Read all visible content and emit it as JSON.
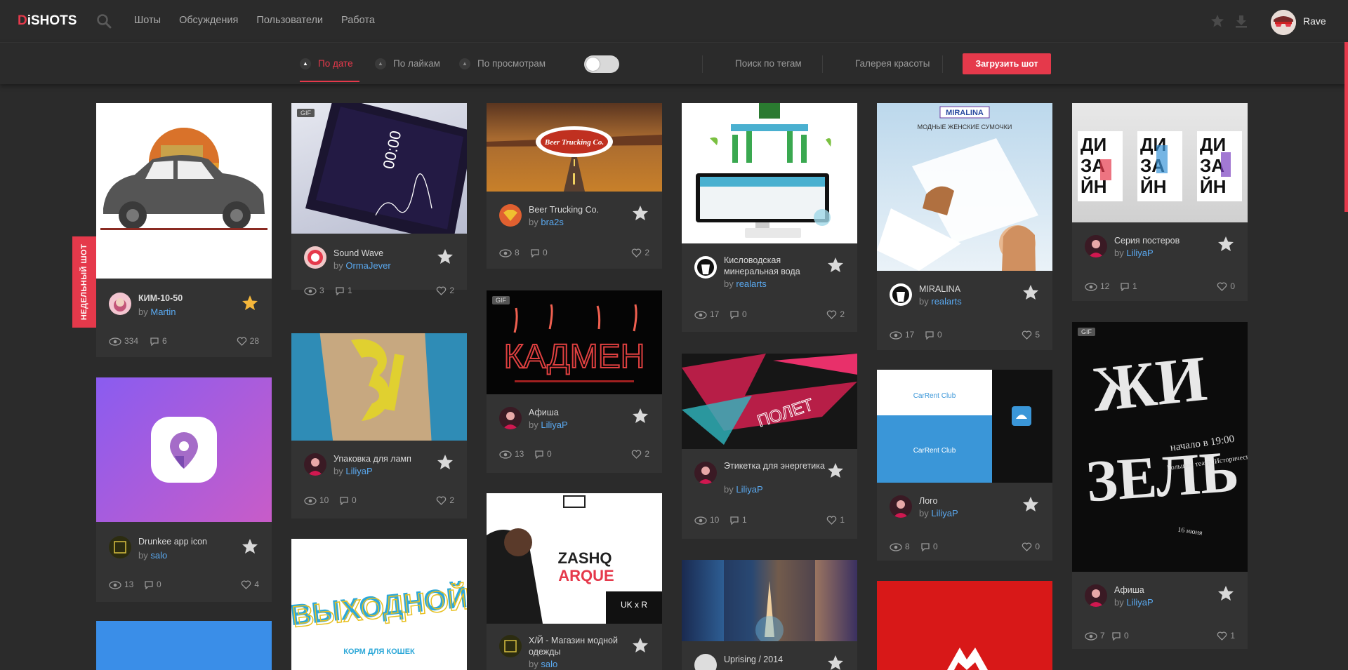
{
  "header": {
    "logo_prefix": "D",
    "logo_rest": "iSHOTS",
    "nav": [
      "Шоты",
      "Обсуждения",
      "Пользователи",
      "Работа"
    ],
    "user_name": "Rave"
  },
  "sortbar": {
    "sort_date": "По дате",
    "sort_likes": "По лайкам",
    "sort_views": "По просмотрам",
    "tag_search": "Поиск по тегам",
    "gallery": "Галерея красоты",
    "upload": "Загрузить шот"
  },
  "weekly_label": "НЕДЕЛЬНЫЙ ШОТ",
  "gif_label": "GIF",
  "by": "by",
  "cards": [
    {
      "title": "КИМ-10-50",
      "author": "Martin",
      "views": "334",
      "comments": "6",
      "likes": "28"
    },
    {
      "title": "Drunkee app icon",
      "author": "salo",
      "views": "13",
      "comments": "0",
      "likes": "4"
    },
    {
      "title": "Sound Wave",
      "author": "OrmaJever",
      "views": "3",
      "comments": "1",
      "likes": "2"
    },
    {
      "title": "Упаковка для ламп",
      "author": "LiliyaP",
      "views": "10",
      "comments": "0",
      "likes": "2"
    },
    {
      "title": "Beer Trucking Co.",
      "author": "bra2s",
      "views": "8",
      "comments": "0",
      "likes": "2"
    },
    {
      "title": "Афиша",
      "author": "LiliyaP",
      "views": "13",
      "comments": "0",
      "likes": "2"
    },
    {
      "title": "Х/Й - Магазин модной одежды",
      "author": "salo",
      "views": "",
      "comments": "",
      "likes": ""
    },
    {
      "title": "Кисловодская минеральная вода",
      "author": "realarts",
      "views": "17",
      "comments": "0",
      "likes": "2"
    },
    {
      "title": "Этикетка для энергетика",
      "author": "LiliyaP",
      "views": "10",
      "comments": "1",
      "likes": "1"
    },
    {
      "title": "Uprising / 2014",
      "author": "",
      "views": "",
      "comments": "",
      "likes": ""
    },
    {
      "title": "MIRALINA",
      "author": "realarts",
      "views": "17",
      "comments": "0",
      "likes": "5"
    },
    {
      "title": "Лого",
      "author": "LiliyaP",
      "views": "8",
      "comments": "0",
      "likes": "0"
    },
    {
      "title": "Серия постеров",
      "author": "LiliyaP",
      "views": "12",
      "comments": "1",
      "likes": "0"
    },
    {
      "title": "Афиша",
      "author": "LiliyaP",
      "views": "7",
      "comments": "0",
      "likes": "1"
    }
  ],
  "artwork_text": {
    "beer_logo": "Beer Trucking Co.",
    "kadmen": "КАДМЕН",
    "sound_time": "00:00",
    "vykhodnoy": "ВЫХОДНОЙ",
    "korm": "КОРМ ДЛЯ КОШЕК",
    "zashq1": "ZASHQ",
    "zashq2": "ARQUE",
    "ukxr": "UK x R",
    "miralina": "MIRALINA",
    "miralina_sub": "МОДНЫЕ ЖЕНСКИЕ СУМОЧКИ",
    "carrent": "CarRent Club",
    "polet": "ПОЛЕТ",
    "diz1": "ДИ",
    "diz2": "ЗА",
    "diz3": "ЙН",
    "gizel1": "ЖИ",
    "gizel2": "ЗЕЛЬ",
    "gizel_info": "начало в 19:00",
    "gizel_place": "Большой театр, Историческая сцена",
    "gizel_date": "16 июня"
  },
  "colors": {
    "accent": "#e5394b",
    "link": "#5aa9f0",
    "card_bg": "#333333",
    "page_bg": "#2b2b2b"
  }
}
